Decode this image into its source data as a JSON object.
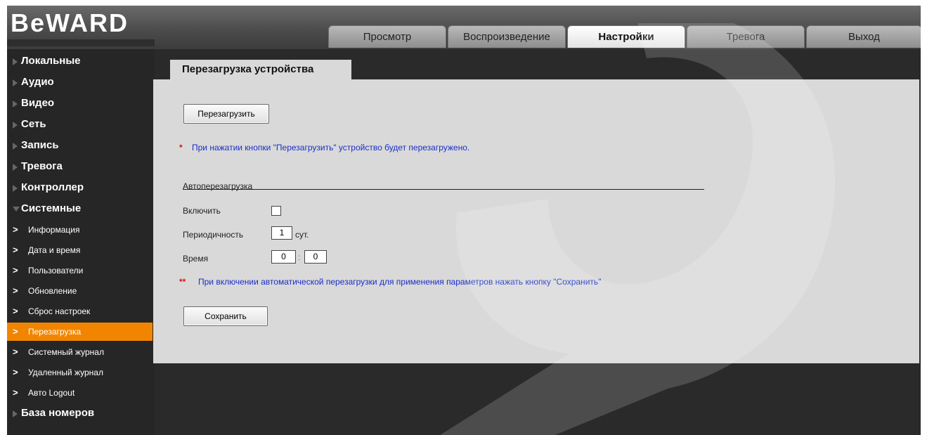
{
  "header": {
    "logo": "BeWARD",
    "tabs": [
      {
        "label": "Просмотр",
        "state": "normal"
      },
      {
        "label": "Воспроизведение",
        "state": "normal"
      },
      {
        "label": "Настройки",
        "state": "active"
      },
      {
        "label": "Тревога",
        "state": "dim"
      },
      {
        "label": "Выход",
        "state": "normal"
      }
    ]
  },
  "sidebar": {
    "items": [
      {
        "label": "Локальные",
        "type": "top"
      },
      {
        "label": "Аудио",
        "type": "top"
      },
      {
        "label": "Видео",
        "type": "top"
      },
      {
        "label": "Сеть",
        "type": "top"
      },
      {
        "label": "Запись",
        "type": "top"
      },
      {
        "label": "Тревога",
        "type": "top"
      },
      {
        "label": "Контроллер",
        "type": "top"
      },
      {
        "label": "Системные",
        "type": "top-expanded"
      },
      {
        "label": "Информация",
        "type": "sub"
      },
      {
        "label": "Дата и время",
        "type": "sub"
      },
      {
        "label": "Пользователи",
        "type": "sub"
      },
      {
        "label": "Обновление",
        "type": "sub"
      },
      {
        "label": "Сброс настроек",
        "type": "sub"
      },
      {
        "label": "Перезагрузка",
        "type": "sub-active"
      },
      {
        "label": "Системный журнал",
        "type": "sub"
      },
      {
        "label": "Удаленный журнал",
        "type": "sub"
      },
      {
        "label": "Авто Logout",
        "type": "sub"
      },
      {
        "label": "База номеров",
        "type": "top"
      }
    ]
  },
  "content": {
    "tab_title": "Перезагрузка устройства",
    "reboot_button": "Перезагрузить",
    "note1_mark": "*",
    "note1_text": "При нажатии кнопки \"Перезагрузить\" устройство будет перезагружено.",
    "autoreboot_heading": "Автоперезагрузка",
    "enable_label": "Включить",
    "enable_checked": false,
    "period_label": "Периодичность",
    "period_value": "1",
    "period_unit": "сут.",
    "time_label": "Время",
    "time_hour": "0",
    "time_sep": ":",
    "time_minute": "0",
    "note2_mark": "**",
    "note2_text": "При включении автоматической перезагрузки для применения параметров нажать кнопку \"Сохранить\"",
    "save_button": "Сохранить"
  },
  "colors": {
    "accent": "#f28500",
    "note_text": "#1a2ec8",
    "note_mark": "#e01010",
    "panel": "#d9d9d9"
  }
}
